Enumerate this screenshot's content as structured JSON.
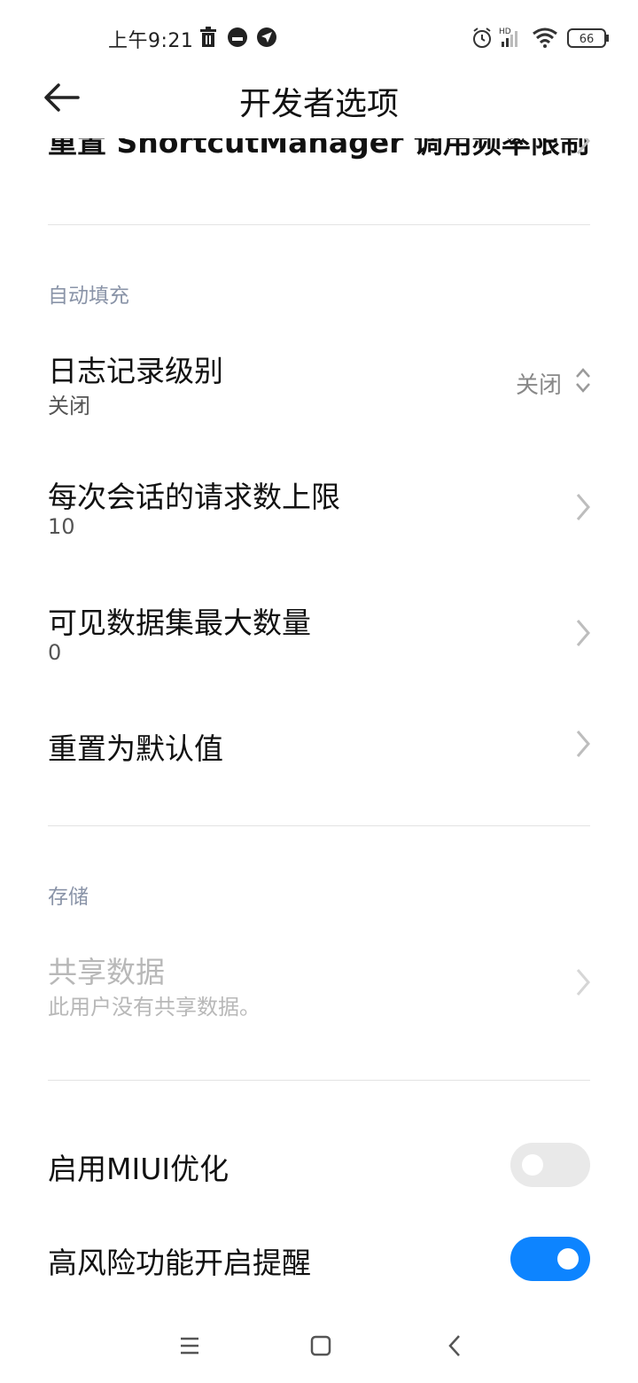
{
  "status_bar": {
    "time": "上午9:21",
    "battery": "66",
    "signal_label": "HD",
    "icons": [
      "trash-icon",
      "notification-circle-icon",
      "send-app-icon",
      "alarm-icon",
      "signal-icon",
      "wifi-icon",
      "battery-icon"
    ]
  },
  "header": {
    "title": "开发者选项",
    "back_icon": "arrow-left-icon"
  },
  "clipped_row": {
    "label": "重置 ShortcutManager 调用频率限制"
  },
  "sections": {
    "autofill": {
      "header": "自动填充",
      "log_level": {
        "title": "日志记录级别",
        "subtitle": "关闭",
        "value": "关闭"
      },
      "max_requests": {
        "title": "每次会话的请求数上限",
        "subtitle": "10"
      },
      "max_datasets": {
        "title": "可见数据集最大数量",
        "subtitle": "0"
      },
      "reset_default": {
        "title": "重置为默认值"
      }
    },
    "storage": {
      "header": "存储",
      "shared_data": {
        "title": "共享数据",
        "subtitle": "此用户没有共享数据。"
      }
    },
    "misc": {
      "miui_opt": {
        "title": "启用MIUI优化",
        "enabled": false
      },
      "risk_alert": {
        "title": "高风险功能开启提醒",
        "enabled": true
      }
    }
  },
  "nav": {
    "icons": [
      "menu-icon",
      "home-icon",
      "back-icon"
    ]
  },
  "colors": {
    "accent": "#0d84ff",
    "section_header": "#8a94a8",
    "divider": "#e3e3e3"
  }
}
